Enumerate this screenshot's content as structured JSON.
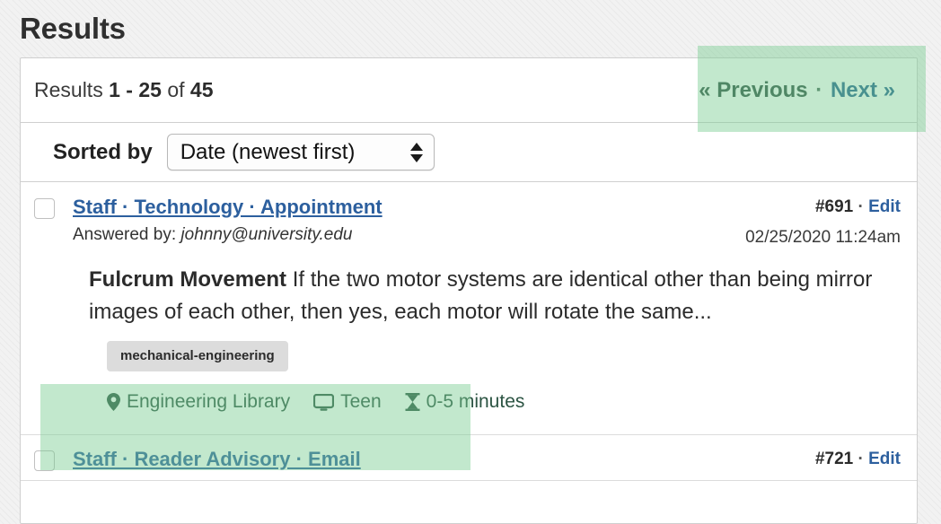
{
  "page": {
    "title": "Results"
  },
  "count_bar": {
    "prefix": "Results ",
    "range_start": "1",
    "dash": " - ",
    "range_end": "25",
    "of": " of ",
    "total": "45"
  },
  "pagination": {
    "previous_label": "« Previous",
    "separator": " · ",
    "next_label": "Next »"
  },
  "sorting": {
    "label": "Sorted by",
    "selected_option": "Date (newest first)",
    "stepper_icon": "stepper-updown-icon"
  },
  "results": [
    {
      "checkbox_checked": false,
      "title": "Staff · Technology · Appointment",
      "answered_by_prefix": "Answered by: ",
      "answered_by_email": "johnny@university.edu",
      "id": "#691",
      "id_separator": " · ",
      "edit_label": "Edit",
      "timestamp": "02/25/2020 11:24am",
      "excerpt_title": "Fulcrum Movement",
      "excerpt_body": " If the two motor systems are identical other than being mirror images of each other, then yes, each motor will rotate the same...",
      "tags": [
        "mechanical-engineering"
      ],
      "meta": [
        {
          "icon": "map-pin-icon",
          "label": "Engineering Library"
        },
        {
          "icon": "monitor-icon",
          "label": "Teen"
        },
        {
          "icon": "hourglass-icon",
          "label": "0-5 minutes"
        }
      ]
    },
    {
      "checkbox_checked": false,
      "title": "Staff · Reader Advisory · Email",
      "id": "#721",
      "id_separator": " · ",
      "edit_label": "Edit"
    }
  ],
  "colors": {
    "link_blue": "#2c5f9e",
    "highlight_green": "#78cd91",
    "meta_text_green": "#2c5443",
    "panel_border": "#cfcfcf",
    "tag_background": "#dcdcdc",
    "page_background": "#f2f2f2"
  }
}
